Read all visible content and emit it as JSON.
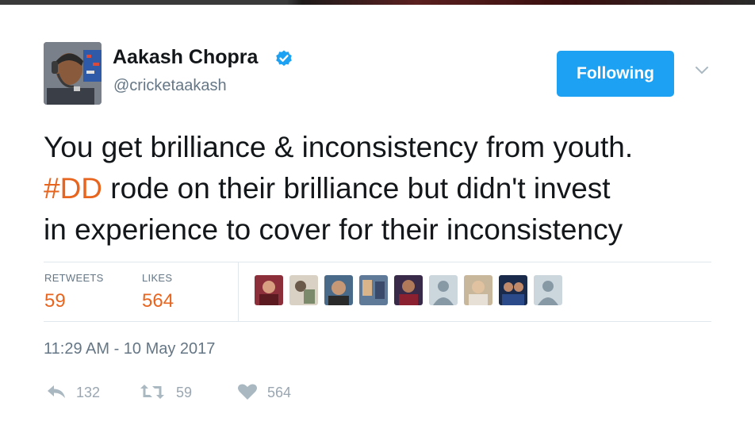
{
  "author": {
    "name": "Aakash Chopra",
    "handle": "@cricketaakash",
    "verified": true
  },
  "follow_button": {
    "label": "Following",
    "color": "#1da1f2"
  },
  "tweet": {
    "line1": "You get brilliance & inconsistency from youth.",
    "hashtag": "#DD",
    "line2_rest": " rode on their brilliance but didn't invest",
    "line3": "in experience to cover for their inconsistency"
  },
  "stats": {
    "retweets_label": "RETWEETS",
    "retweets_value": "59",
    "likes_label": "LIKES",
    "likes_value": "564"
  },
  "likers": [
    "photo",
    "photo",
    "photo",
    "photo",
    "photo",
    "default-avatar",
    "photo",
    "photo",
    "default-avatar"
  ],
  "timestamp": "11:29 AM - 10 May 2017",
  "actions": {
    "reply_count": "132",
    "retweet_count": "59",
    "like_count": "564"
  },
  "colors": {
    "accent": "#e8651f",
    "muted": "#657786",
    "brand": "#1da1f2"
  }
}
